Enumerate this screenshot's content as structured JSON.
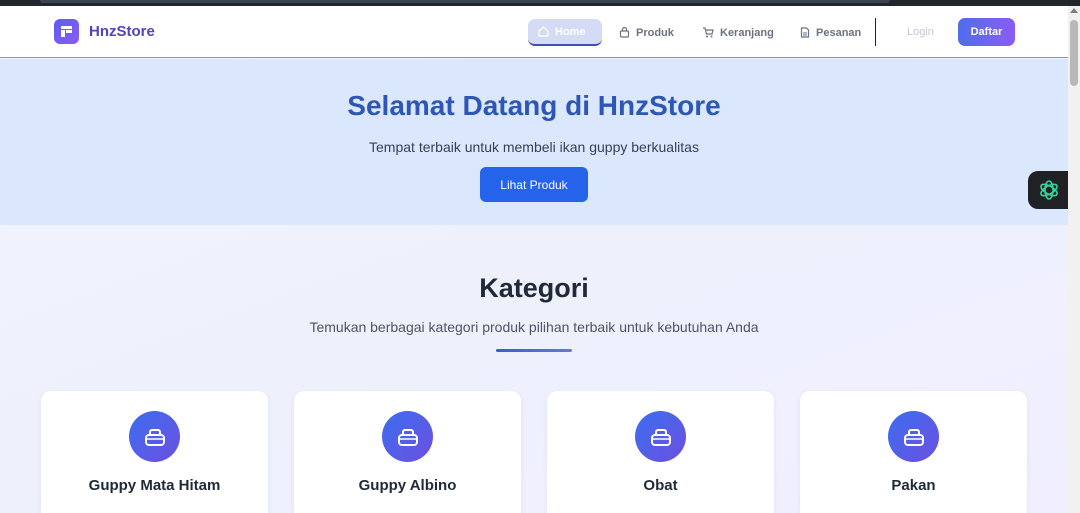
{
  "brand": {
    "name": "HnzStore",
    "logo_icon": "store-icon"
  },
  "nav": {
    "items": [
      {
        "label": "Home",
        "icon": "home-icon",
        "active": true
      },
      {
        "label": "Produk",
        "icon": "bag-icon",
        "active": false
      },
      {
        "label": "Keranjang",
        "icon": "cart-icon",
        "active": false
      },
      {
        "label": "Pesanan",
        "icon": "document-icon",
        "active": false
      }
    ],
    "login_label": "Login",
    "register_label": "Daftar"
  },
  "hero": {
    "title": "Selamat Datang di HnzStore",
    "subtitle": "Tempat terbaik untuk membeli ikan guppy berkualitas",
    "button_label": "Lihat Produk"
  },
  "categories": {
    "title": "Kategori",
    "subtitle": "Temukan berbagai kategori produk pilihan terbaik untuk kebutuhan Anda",
    "items": [
      {
        "label": "Guppy Mata Hitam",
        "icon": "bag-icon"
      },
      {
        "label": "Guppy Albino",
        "icon": "bag-icon"
      },
      {
        "label": "Obat",
        "icon": "bag-icon"
      },
      {
        "label": "Pakan",
        "icon": "bag-icon"
      }
    ]
  },
  "colors": {
    "accent": "#2563eb",
    "brand": "#4f46b8",
    "hero_bg": "#dbe7fd",
    "title_blue": "#2e56b4"
  },
  "widget": {
    "icon": "openai-icon"
  }
}
